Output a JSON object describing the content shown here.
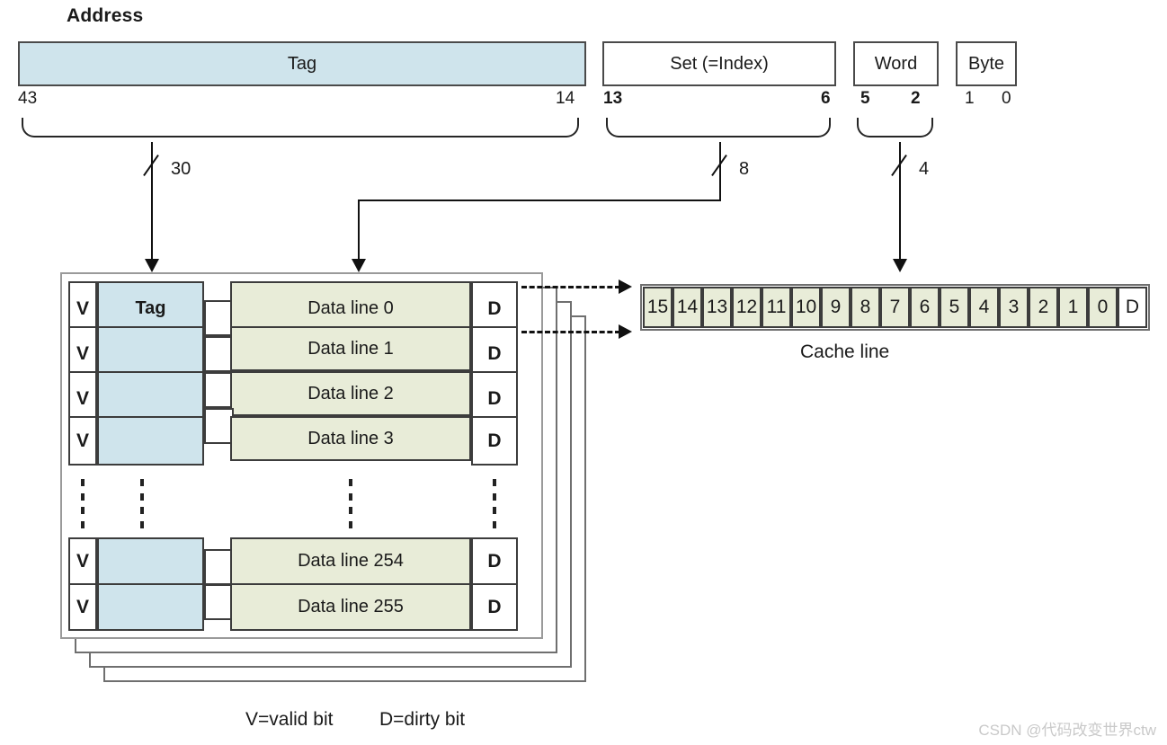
{
  "diagram": {
    "title": "Address",
    "address_fields": [
      {
        "label": "Tag",
        "hi": "43",
        "lo": "14",
        "bold_bits": false,
        "shaded": true
      },
      {
        "label": "Set (=Index)",
        "hi": "13",
        "lo": "6",
        "bold_bits": true,
        "shaded": false
      },
      {
        "label": "Word",
        "hi": "5",
        "lo": "2",
        "bold_bits": true,
        "shaded": false
      },
      {
        "label": "Byte",
        "hi": "1",
        "lo": "0",
        "bold_bits": false,
        "shaded": false
      }
    ],
    "bus_widths": {
      "tag": "30",
      "set": "8",
      "word": "4"
    },
    "cache_array": {
      "valid_label": "V",
      "dirty_label": "D",
      "tag_header": "Tag",
      "rows_top": [
        {
          "data": "Data line 0"
        },
        {
          "data": "Data line 1"
        },
        {
          "data": "Data line 2"
        },
        {
          "data": "Data line 3"
        }
      ],
      "rows_bottom": [
        {
          "data": "Data line 254"
        },
        {
          "data": "Data line 255"
        }
      ],
      "ellipsis": "vertical-dots",
      "ways": 4
    },
    "cache_line": {
      "caption": "Cache line",
      "words": [
        "15",
        "14",
        "13",
        "12",
        "11",
        "10",
        "9",
        "8",
        "7",
        "6",
        "5",
        "4",
        "3",
        "2",
        "1",
        "0"
      ],
      "dirty_label": "D"
    },
    "legend": {
      "valid": "V=valid bit",
      "dirty": "D=dirty bit"
    },
    "watermark": "CSDN @代码改变世界ctw",
    "colors": {
      "tag_fill": "#cfe4ec",
      "data_fill": "#e8ecd8",
      "border": "#3c3c3c",
      "line": "#111111"
    }
  }
}
